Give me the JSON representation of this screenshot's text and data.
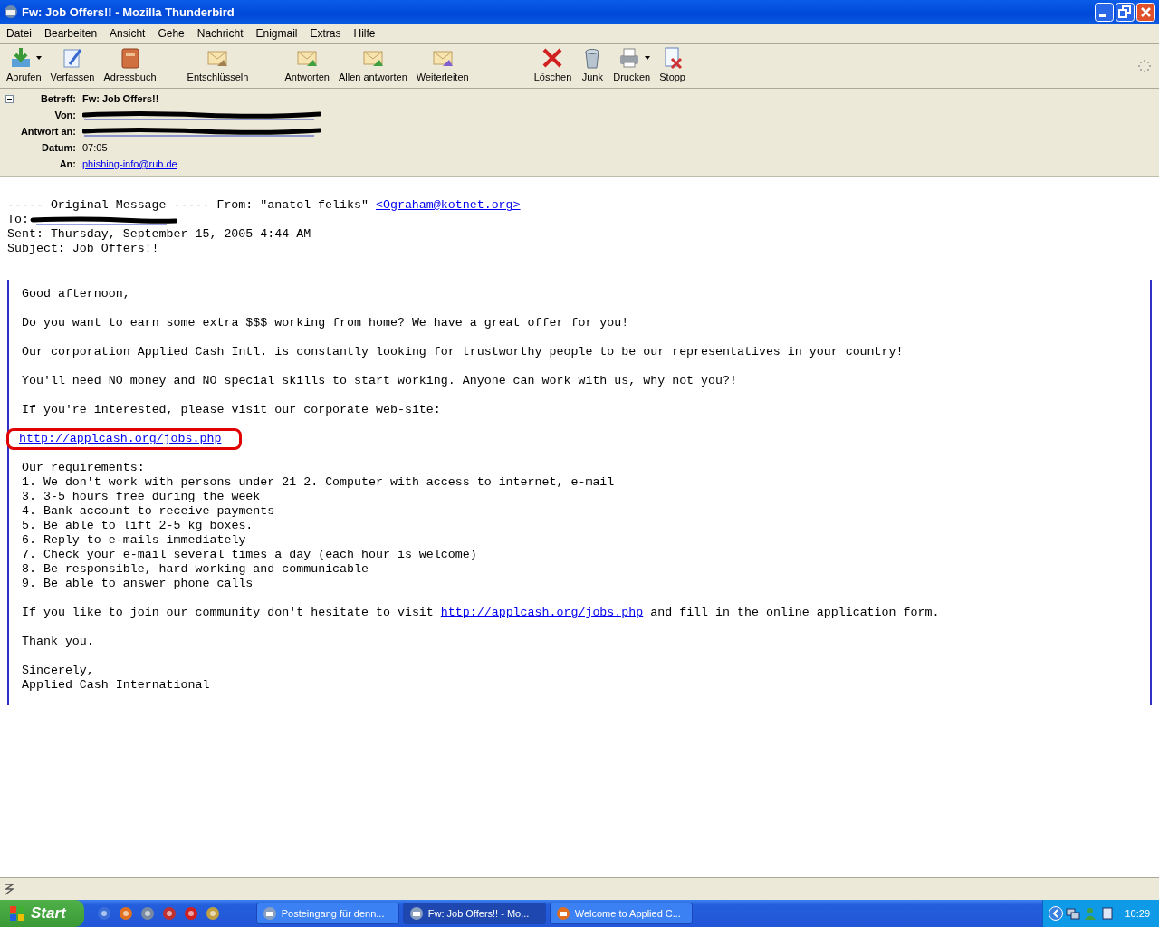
{
  "window": {
    "title": "Fw: Job Offers!! - Mozilla Thunderbird"
  },
  "menu": [
    "Datei",
    "Bearbeiten",
    "Ansicht",
    "Gehe",
    "Nachricht",
    "Enigmail",
    "Extras",
    "Hilfe"
  ],
  "toolbar": [
    {
      "label": "Abrufen",
      "dropdown": true
    },
    {
      "label": "Verfassen",
      "dropdown": false
    },
    {
      "label": "Adressbuch",
      "dropdown": false
    },
    {
      "label": "Entschlüsseln",
      "dropdown": false
    },
    {
      "label": "Antworten",
      "dropdown": false
    },
    {
      "label": "Allen antworten",
      "dropdown": false
    },
    {
      "label": "Weiterleiten",
      "dropdown": false
    },
    {
      "label": "Löschen",
      "dropdown": false
    },
    {
      "label": "Junk",
      "dropdown": false
    },
    {
      "label": "Drucken",
      "dropdown": true
    },
    {
      "label": "Stopp",
      "dropdown": false
    }
  ],
  "header": {
    "expanded": true,
    "fields": [
      {
        "label": "Betreff:",
        "kind": "subject",
        "value": "Fw: Job Offers!!"
      },
      {
        "label": "Von:",
        "kind": "redacted"
      },
      {
        "label": "Antwort an:",
        "kind": "redacted"
      },
      {
        "label": "Datum:",
        "kind": "text",
        "value": "07:05"
      },
      {
        "label": "An:",
        "kind": "link",
        "value": "phishing-info@rub.de"
      }
    ]
  },
  "forwarded": {
    "intro": "----- Original Message ----- From: \"anatol feliks\"",
    "from_link": "<Ograham@kotnet.org>",
    "to_label": "To:",
    "sent": "Sent: Thursday, September 15, 2005 4:44 AM",
    "subject": "Subject: Job Offers!!"
  },
  "quote": [
    {
      "kind": "line",
      "text": "Good afternoon,"
    },
    {
      "kind": "blank"
    },
    {
      "kind": "line",
      "text": "Do you want to earn some extra $$$ working from home? We have a great offer for you!"
    },
    {
      "kind": "blank"
    },
    {
      "kind": "line",
      "text": "Our corporation Applied Cash Intl. is constantly looking for trustworthy people to be our representatives in your country!"
    },
    {
      "kind": "blank"
    },
    {
      "kind": "line",
      "text": "You'll need NO money and NO special skills to start working. Anyone can work with us, why not you?!"
    },
    {
      "kind": "blank"
    },
    {
      "kind": "line",
      "text": "If you're interested, please visit our corporate web-site:"
    },
    {
      "kind": "blank"
    },
    {
      "kind": "link",
      "text": "http://applcash.org/jobs.php",
      "circled": true
    },
    {
      "kind": "blank"
    },
    {
      "kind": "line",
      "text": "Our requirements:"
    },
    {
      "kind": "line",
      "text": "1. We don't work with persons under 21 2. Computer with access to internet, e-mail"
    },
    {
      "kind": "line",
      "text": "3. 3-5 hours free during the week"
    },
    {
      "kind": "line",
      "text": "4. Bank account to receive payments"
    },
    {
      "kind": "line",
      "text": "5. Be able to lift 2-5 kg boxes."
    },
    {
      "kind": "line",
      "text": "6. Reply to e-mails immediately"
    },
    {
      "kind": "line",
      "text": "7. Check your e-mail several times a day (each hour is welcome)"
    },
    {
      "kind": "line",
      "text": "8. Be responsible, hard working and communicable"
    },
    {
      "kind": "line",
      "text": "9. Be able to answer phone calls"
    },
    {
      "kind": "blank"
    },
    {
      "kind": "mixed",
      "before": "If you like to join our community don't hesitate to visit",
      "link": "http://applcash.org/jobs.php",
      "after": "and fill in the online application form."
    },
    {
      "kind": "blank"
    },
    {
      "kind": "line",
      "text": "Thank you."
    },
    {
      "kind": "blank"
    },
    {
      "kind": "line",
      "text": "Sincerely,"
    },
    {
      "kind": "line",
      "text": "Applied Cash International"
    }
  ],
  "taskbar": {
    "start": "Start",
    "tasks": [
      {
        "label": "Posteingang für denn...",
        "selected": false
      },
      {
        "label": "Fw: Job Offers!! - Mo...",
        "selected": true
      },
      {
        "label": "Welcome to Applied C...",
        "selected": false
      }
    ],
    "clock": "10:29"
  }
}
